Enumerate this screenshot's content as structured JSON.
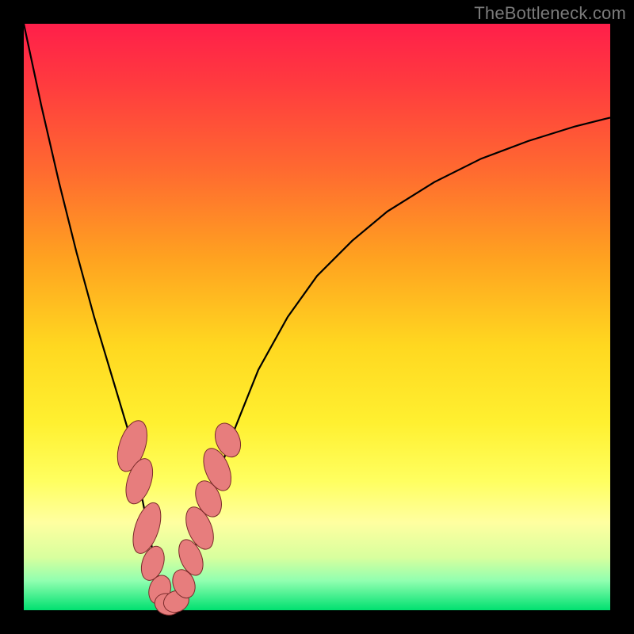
{
  "watermark": "TheBottleneck.com",
  "colors": {
    "frame": "#000000",
    "curve": "#000000",
    "marker_fill": "#e77d7d",
    "marker_stroke": "#7a2a2a"
  },
  "chart_data": {
    "type": "line",
    "title": "",
    "xlabel": "",
    "ylabel": "",
    "xlim": [
      0,
      100
    ],
    "ylim": [
      0,
      100
    ],
    "series": [
      {
        "name": "bottleneck-curve",
        "x": [
          0,
          3,
          6,
          9,
          12,
          15,
          18,
          20,
          22,
          23.5,
          25,
          27,
          29,
          32,
          36,
          40,
          45,
          50,
          56,
          62,
          70,
          78,
          86,
          94,
          100
        ],
        "y": [
          100,
          86,
          73,
          61,
          50,
          40,
          30,
          20,
          10,
          3,
          0,
          4,
          10,
          20,
          31,
          41,
          50,
          57,
          63,
          68,
          73,
          77,
          80,
          82.5,
          84
        ]
      }
    ],
    "markers": [
      {
        "x": 18.5,
        "y": 28,
        "rx": 2.2,
        "ry": 4.5
      },
      {
        "x": 19.7,
        "y": 22,
        "rx": 2.0,
        "ry": 4.0
      },
      {
        "x": 21.0,
        "y": 14,
        "rx": 2.0,
        "ry": 4.5
      },
      {
        "x": 22.0,
        "y": 8,
        "rx": 1.8,
        "ry": 3.0
      },
      {
        "x": 23.2,
        "y": 3.5,
        "rx": 1.8,
        "ry": 2.5
      },
      {
        "x": 24.5,
        "y": 1,
        "rx": 2.2,
        "ry": 1.8
      },
      {
        "x": 26.0,
        "y": 1.5,
        "rx": 2.2,
        "ry": 1.8
      },
      {
        "x": 27.3,
        "y": 4.5,
        "rx": 1.8,
        "ry": 2.5
      },
      {
        "x": 28.5,
        "y": 9,
        "rx": 1.8,
        "ry": 3.2
      },
      {
        "x": 30.0,
        "y": 14,
        "rx": 2.0,
        "ry": 3.8
      },
      {
        "x": 31.5,
        "y": 19,
        "rx": 2.0,
        "ry": 3.2
      },
      {
        "x": 33.0,
        "y": 24,
        "rx": 2.0,
        "ry": 3.8
      },
      {
        "x": 34.8,
        "y": 29,
        "rx": 2.0,
        "ry": 3.0
      }
    ]
  }
}
